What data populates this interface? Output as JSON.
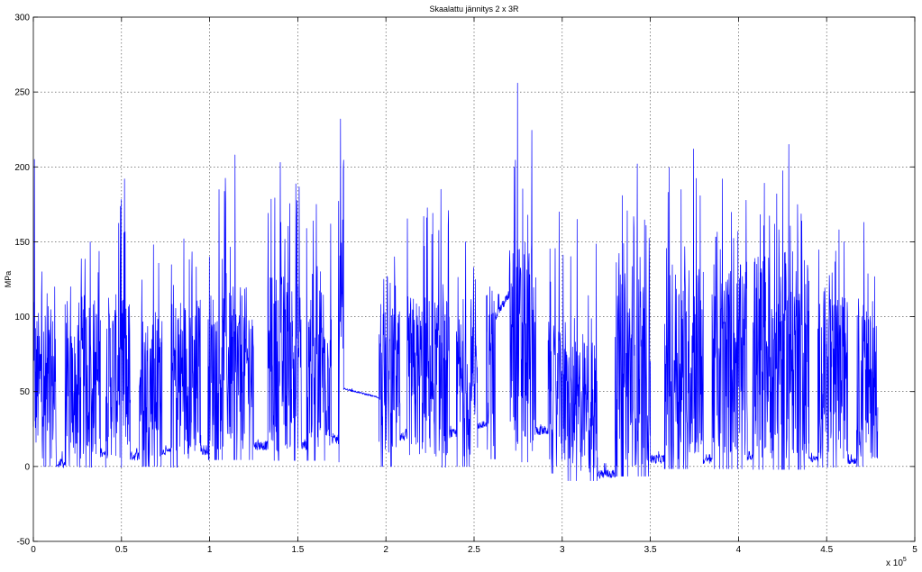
{
  "chart_data": {
    "type": "line",
    "title": "Skaalattu jännitys 2 x 3R",
    "xlabel": "",
    "ylabel": "MPa",
    "x_multiplier_label": "x 10",
    "x_multiplier_exponent": "5",
    "xlim": [
      0,
      5
    ],
    "ylim": [
      -50,
      300
    ],
    "xticks": [
      0,
      0.5,
      1,
      1.5,
      2,
      2.5,
      3,
      3.5,
      4,
      4.5,
      5
    ],
    "xtick_labels": [
      "0",
      "0.5",
      "1",
      "1.5",
      "2",
      "2.5",
      "3",
      "3.5",
      "4",
      "4.5",
      "5"
    ],
    "yticks": [
      -50,
      0,
      50,
      100,
      150,
      200,
      250,
      300
    ],
    "ytick_labels": [
      "-50",
      "0",
      "50",
      "100",
      "150",
      "200",
      "250",
      "300"
    ],
    "grid": true,
    "series": [
      {
        "color": "#0000ff",
        "segments": [
          {
            "x": [
              0.0,
              0.01
            ],
            "base": 50,
            "spread": 60,
            "peak": 205
          },
          {
            "x": [
              0.01,
              0.13
            ],
            "base": 55,
            "spread": 50,
            "peak": 130
          },
          {
            "x": [
              0.14,
              0.18
            ],
            "base": 2,
            "spread": 4,
            "peak": 10
          },
          {
            "x": [
              0.18,
              0.26
            ],
            "base": 50,
            "spread": 45,
            "peak": 120
          },
          {
            "x": [
              0.26,
              0.38
            ],
            "base": 60,
            "spread": 55,
            "peak": 150
          },
          {
            "x": [
              0.38,
              0.41
            ],
            "base": 8,
            "spread": 3,
            "peak": 12
          },
          {
            "x": [
              0.41,
              0.55
            ],
            "base": 60,
            "spread": 55,
            "peak": 192
          },
          {
            "x": [
              0.55,
              0.6
            ],
            "base": 7,
            "spread": 4,
            "peak": 12
          },
          {
            "x": [
              0.6,
              0.73
            ],
            "base": 55,
            "spread": 50,
            "peak": 148
          },
          {
            "x": [
              0.73,
              0.78
            ],
            "base": 10,
            "spread": 3,
            "peak": 14
          },
          {
            "x": [
              0.78,
              0.95
            ],
            "base": 60,
            "spread": 55,
            "peak": 152
          },
          {
            "x": [
              0.95,
              0.99
            ],
            "base": 10,
            "spread": 3,
            "peak": 14
          },
          {
            "x": [
              0.99,
              1.25
            ],
            "base": 65,
            "spread": 55,
            "peak": 208
          },
          {
            "x": [
              1.25,
              1.33
            ],
            "base": 14,
            "spread": 4,
            "peak": 18
          },
          {
            "x": [
              1.33,
              1.52
            ],
            "base": 70,
            "spread": 60,
            "peak": 203
          },
          {
            "x": [
              1.52,
              1.55
            ],
            "base": 14,
            "spread": 4,
            "peak": 18
          },
          {
            "x": [
              1.55,
              1.69
            ],
            "base": 70,
            "spread": 60,
            "peak": 175
          },
          {
            "x": [
              1.69,
              1.73
            ],
            "base": 18,
            "spread": 4,
            "peak": 22
          },
          {
            "x": [
              1.73,
              1.76
            ],
            "base": 80,
            "spread": 70,
            "peak": 232
          },
          {
            "x": [
              1.76,
              1.96
            ],
            "base": 52,
            "spread": 1,
            "peak": 52,
            "trend": -6
          },
          {
            "x": [
              1.96,
              2.08
            ],
            "base": 55,
            "spread": 50,
            "peak": 140
          },
          {
            "x": [
              2.08,
              2.12
            ],
            "base": 20,
            "spread": 4,
            "peak": 25
          },
          {
            "x": [
              2.12,
              2.36
            ],
            "base": 60,
            "spread": 55,
            "peak": 185
          },
          {
            "x": [
              2.36,
              2.4
            ],
            "base": 22,
            "spread": 4,
            "peak": 27
          },
          {
            "x": [
              2.4,
              2.52
            ],
            "base": 55,
            "spread": 50,
            "peak": 150
          },
          {
            "x": [
              2.52,
              2.57
            ],
            "base": 27,
            "spread": 3,
            "peak": 30
          },
          {
            "x": [
              2.57,
              2.62
            ],
            "base": 60,
            "spread": 50,
            "peak": 120
          },
          {
            "x": [
              2.62,
              2.7
            ],
            "base": 100,
            "spread": 4,
            "peak": 115,
            "trend": 15
          },
          {
            "x": [
              2.7,
              2.85
            ],
            "base": 80,
            "spread": 70,
            "peak": 256
          },
          {
            "x": [
              2.85,
              2.92
            ],
            "base": 24,
            "spread": 4,
            "peak": 28
          },
          {
            "x": [
              2.92,
              3.0
            ],
            "base": 45,
            "spread": 45,
            "peak": 170
          },
          {
            "x": [
              3.0,
              3.2
            ],
            "base": 40,
            "spread": 45,
            "peak": 165
          },
          {
            "x": [
              3.2,
              3.3
            ],
            "base": -5,
            "spread": 4,
            "peak": 2
          },
          {
            "x": [
              3.3,
              3.5
            ],
            "base": 65,
            "spread": 65,
            "peak": 202
          },
          {
            "x": [
              3.5,
              3.58
            ],
            "base": 5,
            "spread": 4,
            "peak": 10
          },
          {
            "x": [
              3.58,
              3.8
            ],
            "base": 70,
            "spread": 65,
            "peak": 212
          },
          {
            "x": [
              3.8,
              3.85
            ],
            "base": 4,
            "spread": 3,
            "peak": 8
          },
          {
            "x": [
              3.85,
              4.05
            ],
            "base": 70,
            "spread": 65,
            "peak": 192
          },
          {
            "x": [
              4.05,
              4.08
            ],
            "base": 6,
            "spread": 3,
            "peak": 10
          },
          {
            "x": [
              4.08,
              4.4
            ],
            "base": 75,
            "spread": 70,
            "peak": 215
          },
          {
            "x": [
              4.4,
              4.45
            ],
            "base": 5,
            "spread": 3,
            "peak": 9
          },
          {
            "x": [
              4.45,
              4.62
            ],
            "base": 60,
            "spread": 55,
            "peak": 158
          },
          {
            "x": [
              4.62,
              4.67
            ],
            "base": 4,
            "spread": 3,
            "peak": 8
          },
          {
            "x": [
              4.67,
              4.79
            ],
            "base": 55,
            "spread": 50,
            "peak": 163
          }
        ]
      }
    ]
  }
}
